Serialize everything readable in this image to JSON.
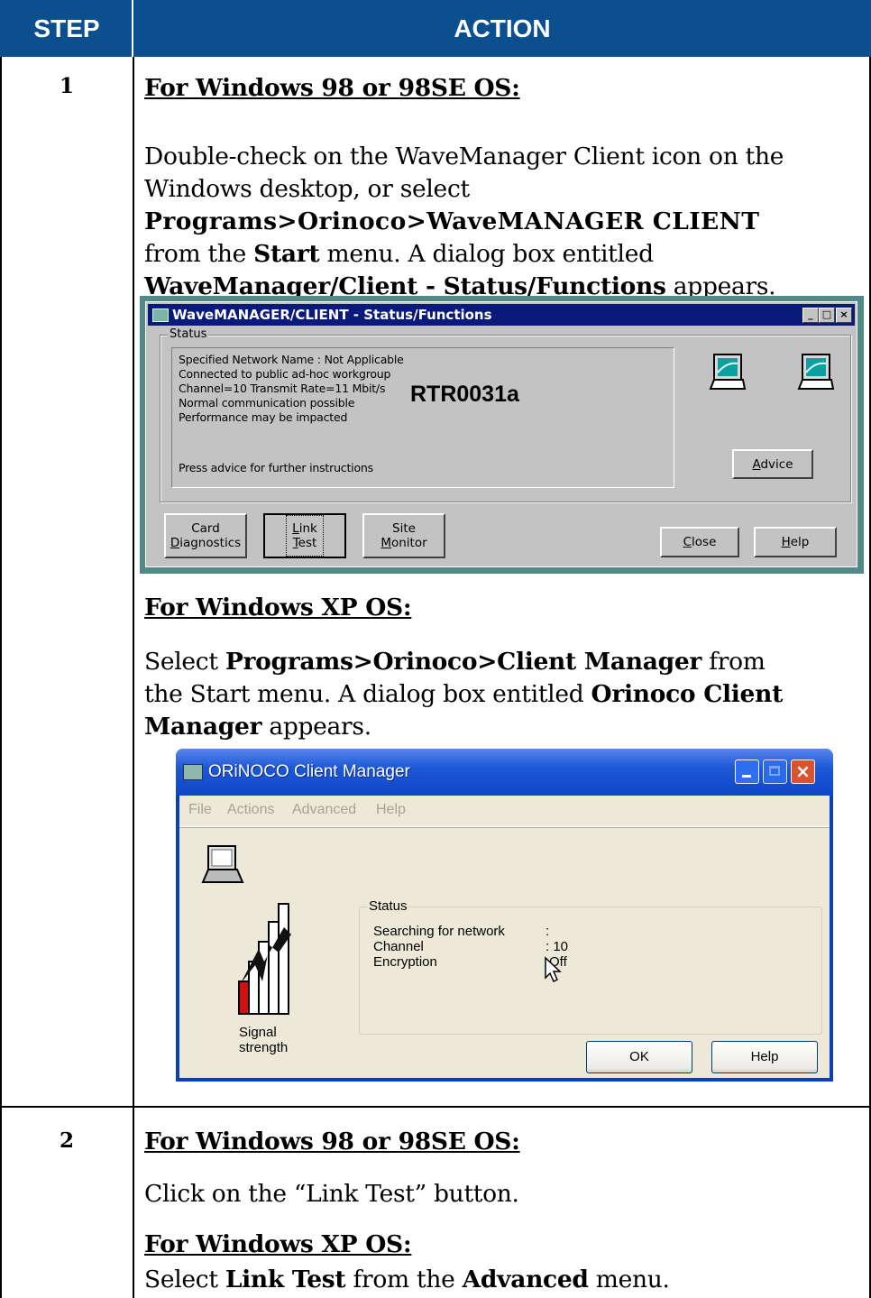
{
  "table": {
    "header": {
      "step": "STEP",
      "action": "ACTION"
    },
    "rows": [
      {
        "step": "1",
        "w98_heading": "For Windows 98 or 98SE OS:",
        "w98_text": {
          "l1": "Double-check on the WaveManager Client icon on the",
          "l2": "Windows desktop, or select",
          "l3_bold": "Programs>Orinoco>WaveMANAGER CLIENT",
          "l4_pre": "from the ",
          "l4_bold": "Start",
          "l4_post": " menu. A dialog box entitled",
          "l5_bold": "WaveManager/Client - Status/Functions",
          "l5_post": " appears."
        },
        "xp_heading": "For Windows XP OS:",
        "xp_text": {
          "l1_pre": "Select ",
          "l1_bold": "Programs>Orinoco>Client Manager",
          "l1_post": " from",
          "l2_pre": "the Start menu. A dialog box entitled ",
          "l2_bold": "Orinoco Client",
          "l3_bold": "Manager",
          "l3_post": " appears."
        }
      },
      {
        "step": "2",
        "w98_heading": "For Windows 98 or 98SE OS:",
        "w98_text": "Click on the “Link Test” button.",
        "xp_heading": "For Windows XP OS:",
        "xp_text": {
          "pre": "Select ",
          "b1": "Link Test",
          "mid": " from the ",
          "b2": "Advanced",
          "post": " menu."
        }
      }
    ]
  },
  "win98_dialog": {
    "title": "WaveMANAGER/CLIENT - Status/Functions",
    "title_buttons": [
      "_",
      "□",
      "×"
    ],
    "status_label": "Status",
    "status_lines": [
      "Specified Network Name : Not Applicable",
      "Connected to public ad-hoc workgroup",
      "Channel=10  Transmit Rate=11 Mbit/s",
      "Normal communication possible",
      "Performance may be impacted"
    ],
    "press_advice": "Press advice for further instructions",
    "advice_button": {
      "accel": "A",
      "rest": "dvice"
    },
    "buttons": {
      "card": {
        "l1": "Card",
        "l2_accel": "D",
        "l2_rest": "iagnostics"
      },
      "link": {
        "l1_accel": "L",
        "l1_rest": "ink",
        "l2_accel": "T",
        "l2_rest": "est"
      },
      "site": {
        "l1": "Site",
        "l2_accel": "M",
        "l2_rest": "onitor"
      },
      "close": {
        "accel": "C",
        "rest": "lose"
      },
      "help": {
        "accel": "H",
        "rest": "elp"
      }
    },
    "watermark": "RTR0031a"
  },
  "xp_dialog": {
    "title": "ORiNOCO Client Manager",
    "menu": [
      "File",
      "Actions",
      "Advanced",
      "Help"
    ],
    "status_label": "Status",
    "status": [
      {
        "label": "Searching for network",
        "value": ":"
      },
      {
        "label": "Channel",
        "value": ": 10"
      },
      {
        "label": "Encryption",
        "value": "Off"
      }
    ],
    "signal_label_1": "Signal",
    "signal_label_2": "strength",
    "ok_button": "OK",
    "help_button": "Help"
  },
  "colors": {
    "header_bg": "#0c4f8e",
    "win98_title": "#0a1a7a",
    "xp_title": "#1d58d6",
    "xp_close": "#d9542c",
    "signal_red": "#d21010"
  }
}
